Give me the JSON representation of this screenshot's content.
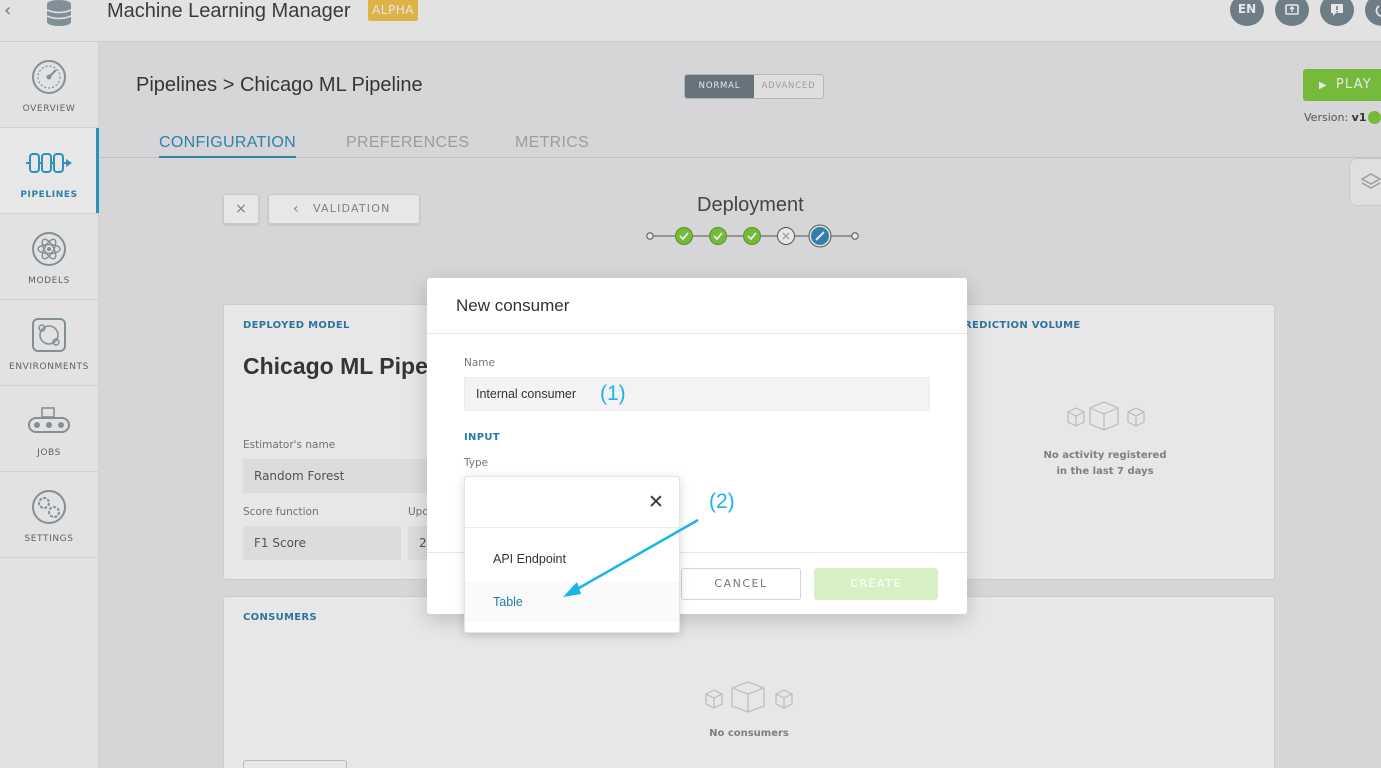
{
  "app": {
    "title": "Machine Learning Manager",
    "badge": "ALPHA"
  },
  "top_actions": [
    {
      "label": "EN",
      "icon": "language-icon"
    },
    {
      "label": "",
      "icon": "screen-share-icon"
    },
    {
      "label": "",
      "icon": "chat-help-icon"
    },
    {
      "label": "",
      "icon": "power-icon"
    }
  ],
  "sidebar": {
    "items": [
      {
        "label": "OVERVIEW",
        "icon": "gauge-icon",
        "active": false
      },
      {
        "label": "PIPELINES",
        "icon": "pipeline-icon",
        "active": true
      },
      {
        "label": "MODELS",
        "icon": "atom-icon",
        "active": false
      },
      {
        "label": "ENVIRONMENTS",
        "icon": "environment-icon",
        "active": false
      },
      {
        "label": "JOBS",
        "icon": "conveyor-icon",
        "active": false
      },
      {
        "label": "SETTINGS",
        "icon": "gears-icon",
        "active": false
      }
    ]
  },
  "header": {
    "breadcrumb_root": "Pipelines",
    "breadcrumb_sep": ">",
    "breadcrumb_current": "Chicago ML Pipeline",
    "mode_normal": "NORMAL",
    "mode_advanced": "ADVANCED",
    "play_label": "PLAY",
    "version_label": "Version:",
    "version_value": "v1"
  },
  "tabs": [
    {
      "label": "CONFIGURATION",
      "active": true
    },
    {
      "label": "PREFERENCES",
      "active": false
    },
    {
      "label": "METRICS",
      "active": false
    }
  ],
  "deployment": {
    "close_label": "×",
    "back_label": "VALIDATION",
    "step_title": "Deployment",
    "steps": [
      "done",
      "done",
      "done",
      "skipped",
      "current"
    ]
  },
  "deployed_model": {
    "section_title": "DEPLOYED MODEL",
    "model_name": "Chicago ML Pipel",
    "estimator_label": "Estimator's name",
    "estimator_value": "Random Forest",
    "score_label": "Score function",
    "score_value": "F1 Score",
    "update_label": "Upd",
    "update_value": "2"
  },
  "prediction_volume": {
    "section_title": "REDICTION VOLUME",
    "empty_line1": "No activity registered",
    "empty_line2": "in the last 7 days"
  },
  "consumers": {
    "section_title": "CONSUMERS",
    "empty_message": "No consumers"
  },
  "modal": {
    "title": "New consumer",
    "name_label": "Name",
    "name_value": "Internal consumer",
    "input_section": "INPUT",
    "type_label": "Type",
    "cancel_label": "CANCEL",
    "create_label": "CREATE"
  },
  "dropdown": {
    "options": [
      "API Endpoint",
      "Table"
    ]
  },
  "annotations": {
    "one": "(1)",
    "two": "(2)"
  },
  "colors": {
    "accent": "#2c8ab8",
    "play_green": "#7dcc38",
    "alpha_badge": "#f3c445",
    "annotation": "#1ab4ea"
  }
}
